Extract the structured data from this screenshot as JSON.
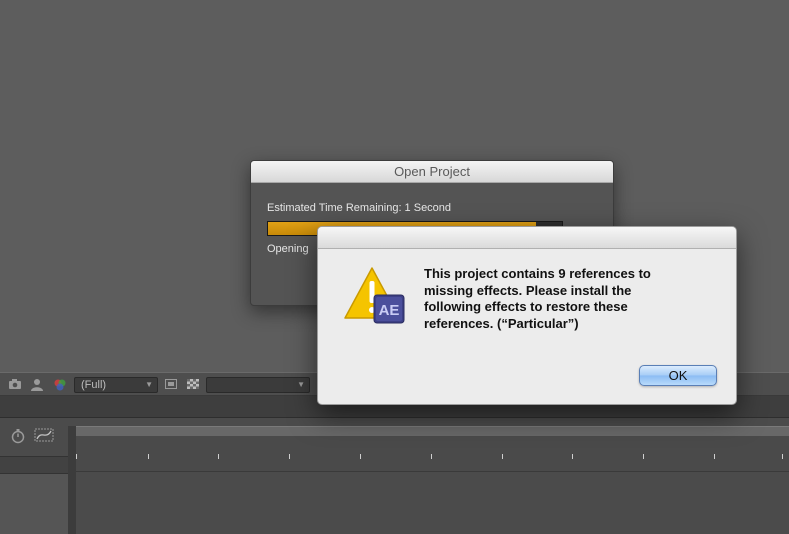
{
  "progress_dialog": {
    "title": "Open Project",
    "time_remaining": "Estimated Time Remaining: 1 Second",
    "progress_percent": 91,
    "status_text": "Opening"
  },
  "alert_dialog": {
    "message": "This project contains 9 references to\nmissing effects. Please install the\nfollowing effects to restore these\nreferences. (“Particular”)",
    "ok_label": "OK",
    "badge_text": "AE"
  },
  "viewer_toolbar": {
    "resolution": "(Full)",
    "view_select": ""
  },
  "icons": {
    "snapshot": "camera-icon",
    "show_snapshot": "person-icon",
    "channel": "color-channel-icon",
    "region": "region-of-interest-icon",
    "transparency": "transparency-grid-icon",
    "timer": "stopwatch-icon",
    "graph": "graph-editor-icon"
  },
  "colors": {
    "accent": "#e0a016",
    "ok_button": "#a6ccf6",
    "warning": "#f5c400"
  }
}
